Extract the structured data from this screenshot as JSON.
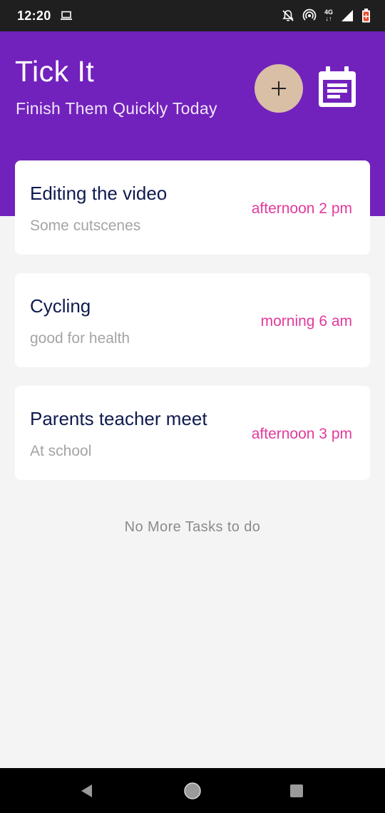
{
  "status_bar": {
    "time": "12:20",
    "network_label_top": "4G",
    "network_label_bottom": "↓↑"
  },
  "header": {
    "title": "Tick It",
    "subtitle": "Finish Them Quickly Today",
    "add_button_icon": "plus-icon",
    "calendar_button_icon": "calendar-icon"
  },
  "tasks": [
    {
      "title": "Editing the video",
      "description": "Some cutscenes",
      "time": "afternoon 2 pm"
    },
    {
      "title": "Cycling",
      "description": "good for health",
      "time": "morning 6 am"
    },
    {
      "title": "Parents teacher meet",
      "description": "At school",
      "time": "afternoon 3 pm"
    }
  ],
  "empty_message": "No More Tasks to do",
  "colors": {
    "header_bg": "#7222bc",
    "add_button_bg": "#d9bfa6",
    "task_title": "#0f1a4f",
    "task_desc": "#a4a4a4",
    "task_time": "#e23a9b",
    "page_bg": "#f4f4f4"
  }
}
